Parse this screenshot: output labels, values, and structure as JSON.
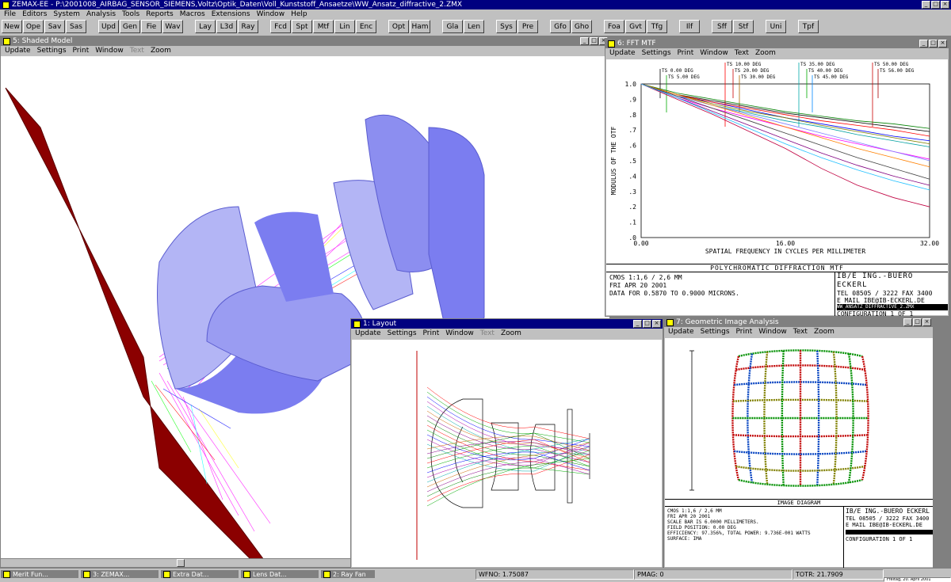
{
  "app": {
    "title": "ZEMAX-EE - P:\\2001008_AIRBAG_SENSOR_SIEMENS,Voltz\\Optik_Daten\\Voll_Kunststoff_Ansaetze\\WW_Ansatz_diffractive_2.ZMX"
  },
  "menu": [
    "File",
    "Editors",
    "System",
    "Analysis",
    "Tools",
    "Reports",
    "Macros",
    "Extensions",
    "Window",
    "Help"
  ],
  "toolbar": [
    "New",
    "Ope",
    "Sav",
    "Sas",
    "Upd",
    "Gen",
    "Fie",
    "Wav",
    "Lay",
    "L3d",
    "Ray",
    "Fcd",
    "Spt",
    "Mtf",
    "Lin",
    "Enc",
    "Opt",
    "Ham",
    "Gla",
    "Len",
    "Sys",
    "Pre",
    "Gfo",
    "Gho",
    "Foa",
    "Gvt",
    "Tfg",
    "Ilf",
    "Sff",
    "Stf",
    "Uni",
    "Tpf"
  ],
  "shaded": {
    "title": "5: Shaded Model",
    "menu": [
      "Update",
      "Settings",
      "Print",
      "Window",
      "Text",
      "Zoom"
    ]
  },
  "mtf": {
    "title": "6: FFT MTF",
    "menu": [
      "Update",
      "Settings",
      "Print",
      "Window",
      "Text",
      "Zoom"
    ],
    "field_labels": [
      "TS 0.00 DEG",
      "TS 5.00 DEG",
      "TS 10.00 DEG",
      "TS 20.00 DEG",
      "TS 30.00 DEG",
      "TS 35.00 DEG",
      "TS 40.00 DEG",
      "TS 45.00 DEG",
      "TS 50.00 DEG",
      "TS 56.00 DEG"
    ],
    "info_title": "POLYCHROMATIC DIFFRACTION MTF",
    "info_lines": [
      "CMOS 1:1,6 / 2,6 MM",
      "FRI APR 20 2001",
      "DATA FOR 0.5870 TO 0.9000 MICRONS."
    ],
    "company": "IB/E ING.-BUERO ECKERL",
    "tel": "TEL 08505 / 3222 FAX 3400",
    "email": "E MAIL IBE@IB-ECKERL.DE",
    "filename": "WW_ANSATZ_DIFFRACTIVE_2.ZMX",
    "config": "CONFIGURATION 1 OF 1"
  },
  "chart_data": {
    "type": "line",
    "title": "",
    "xlabel": "SPATIAL FREQUENCY IN CYCLES PER MILLIMETER",
    "ylabel": "MODULUS OF THE OTF",
    "xlim": [
      0,
      32
    ],
    "ylim": [
      0,
      1
    ],
    "x_ticks": [
      "0.00",
      "16.00",
      "32.00"
    ],
    "y_ticks": [
      "1.0",
      ".9",
      ".8",
      ".7",
      ".6",
      ".5",
      ".4",
      ".3",
      ".2",
      ".1",
      ".0"
    ],
    "grid": false,
    "x": [
      0,
      4,
      8,
      12,
      16,
      20,
      24,
      28,
      32
    ],
    "series": [
      {
        "color": "#000000",
        "values": [
          1.0,
          0.93,
          0.89,
          0.85,
          0.81,
          0.78,
          0.75,
          0.72,
          0.69
        ]
      },
      {
        "color": "#008000",
        "values": [
          1.0,
          0.94,
          0.9,
          0.86,
          0.82,
          0.79,
          0.76,
          0.74,
          0.71
        ]
      },
      {
        "color": "#0000ff",
        "values": [
          1.0,
          0.92,
          0.88,
          0.83,
          0.78,
          0.74,
          0.7,
          0.66,
          0.63
        ]
      },
      {
        "color": "#ff0000",
        "values": [
          1.0,
          0.93,
          0.88,
          0.84,
          0.8,
          0.76,
          0.73,
          0.7,
          0.66
        ]
      },
      {
        "color": "#00a0a0",
        "values": [
          1.0,
          0.92,
          0.86,
          0.81,
          0.76,
          0.72,
          0.67,
          0.63,
          0.59
        ]
      },
      {
        "color": "#808000",
        "values": [
          1.0,
          0.93,
          0.87,
          0.82,
          0.78,
          0.73,
          0.69,
          0.65,
          0.61
        ]
      },
      {
        "color": "#ff00ff",
        "values": [
          1.0,
          0.91,
          0.84,
          0.78,
          0.72,
          0.66,
          0.61,
          0.56,
          0.51
        ]
      },
      {
        "color": "#8080ff",
        "values": [
          1.0,
          0.92,
          0.86,
          0.8,
          0.74,
          0.68,
          0.62,
          0.56,
          0.5
        ]
      },
      {
        "color": "#ff8000",
        "values": [
          1.0,
          0.93,
          0.86,
          0.79,
          0.72,
          0.65,
          0.58,
          0.52,
          0.46
        ]
      },
      {
        "color": "#404040",
        "values": [
          1.0,
          0.92,
          0.84,
          0.76,
          0.68,
          0.6,
          0.52,
          0.45,
          0.38
        ]
      },
      {
        "color": "#800080",
        "values": [
          1.0,
          0.91,
          0.82,
          0.73,
          0.64,
          0.55,
          0.47,
          0.4,
          0.34
        ]
      },
      {
        "color": "#c00040",
        "values": [
          1.0,
          0.9,
          0.8,
          0.69,
          0.58,
          0.45,
          0.34,
          0.26,
          0.2
        ]
      },
      {
        "color": "#20c0ff",
        "values": [
          1.0,
          0.91,
          0.81,
          0.71,
          0.61,
          0.52,
          0.44,
          0.37,
          0.31
        ]
      }
    ]
  },
  "layout": {
    "title": "1: Layout",
    "menu": [
      "Update",
      "Settings",
      "Print",
      "Window",
      "Text",
      "Zoom"
    ]
  },
  "gia": {
    "title": "7: Geometric Image Analysis",
    "menu": [
      "Update",
      "Settings",
      "Print",
      "Window",
      "Text",
      "Zoom"
    ],
    "caption": "IMAGE DIAGRAM",
    "info_lines": [
      "CMOS 1:1,6 / 2,6 MM",
      "FRI APR 20 2001",
      "SCALE BAR IS 6.0000 MILLIMETERS.",
      "FIELD POSITION: 0.00 DEG",
      "EFFICIENCY: 97.356%, TOTAL POWER: 9.736E-001 WATTS",
      "SURFACE: IMA"
    ],
    "company": "IB/E ING.-BUERO ECKERL",
    "tel": "TEL 08505 / 3222 FAX 3400",
    "email": "E MAIL IBE@IB-ECKERL.DE",
    "config": "CONFIGURATION 1 OF 1"
  },
  "minimized": [
    "Merit Fun...",
    "3: ZEMAX...",
    "Extra Dat...",
    "Lens Dat...",
    "2: Ray Fan"
  ],
  "status": {
    "wfno": "WFNO: 1.75087",
    "pmag": "PMAG: 0",
    "totr": "TOTR: 21.7909",
    "tray": "Freitag, 20. April 2001"
  },
  "colors": {
    "titlebar": "#000080",
    "inactive_title": "#808080",
    "lens": "#7b7df0",
    "mount": "#8b0000"
  }
}
